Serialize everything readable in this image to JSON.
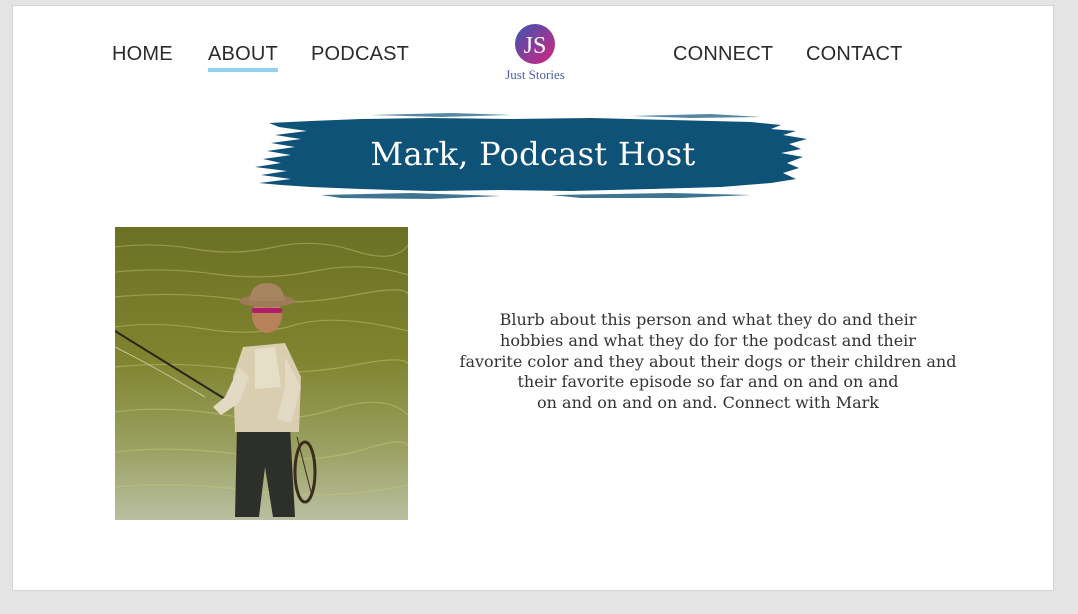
{
  "nav": {
    "home": "HOME",
    "about": "ABOUT",
    "podcast": "PODCAST",
    "connect": "CONNECT",
    "contact": "CONTACT",
    "active": "ABOUT"
  },
  "logo": {
    "monogram": "JS",
    "name": "Just Stories"
  },
  "hero": {
    "title": "Mark, Podcast Host"
  },
  "bio": {
    "lines": [
      "Blurb about this person and what they do and their",
      "hobbies and what they do for the podcast and their",
      "favorite color and they about their dogs or their children and",
      "their favorite episode so far and on and on and",
      "on and on and on and. Connect with Mark"
    ]
  },
  "photo": {
    "alt": "Mark fly fishing in a river"
  },
  "colors": {
    "banner": "#0f5278",
    "nav_underline": "#8fd3f0",
    "logo_gradient_start": "#3b55b3",
    "logo_gradient_end": "#d4247d"
  }
}
